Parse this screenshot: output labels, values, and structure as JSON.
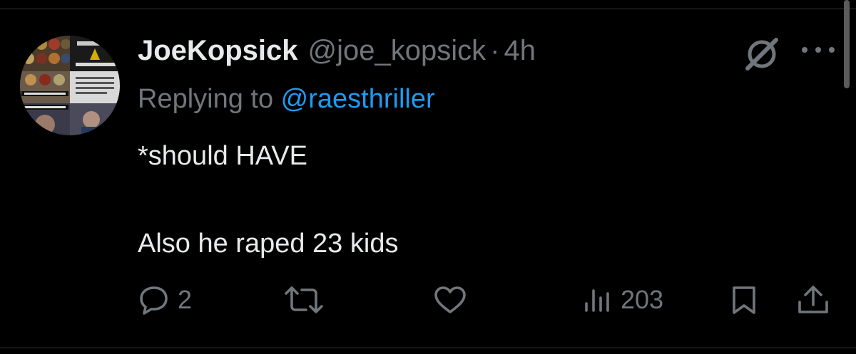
{
  "tweet": {
    "display_name": "JoeKopsick",
    "handle": "@joe_kopsick",
    "separator": "·",
    "time": "4h",
    "replying_prefix": "Replying to ",
    "replying_to": "@raesthriller",
    "text_line1": "*should HAVE",
    "text_line2": "Also he raped 23 kids"
  },
  "actions": {
    "reply_count": "2",
    "retweet_count": "",
    "like_count": "",
    "views_count": "203"
  },
  "icons": {
    "reply": "speech-bubble-icon",
    "retweet": "retweet-arrows-icon",
    "like": "heart-icon",
    "views": "bar-chart-icon",
    "bookmark": "bookmark-icon",
    "share": "share-upload-icon",
    "grok": "grok-icon",
    "more": "ellipsis-icon"
  },
  "colors": {
    "background": "#000000",
    "primary_text": "#e7e9ea",
    "secondary_text": "#71767b",
    "link": "#1d9bf0"
  }
}
